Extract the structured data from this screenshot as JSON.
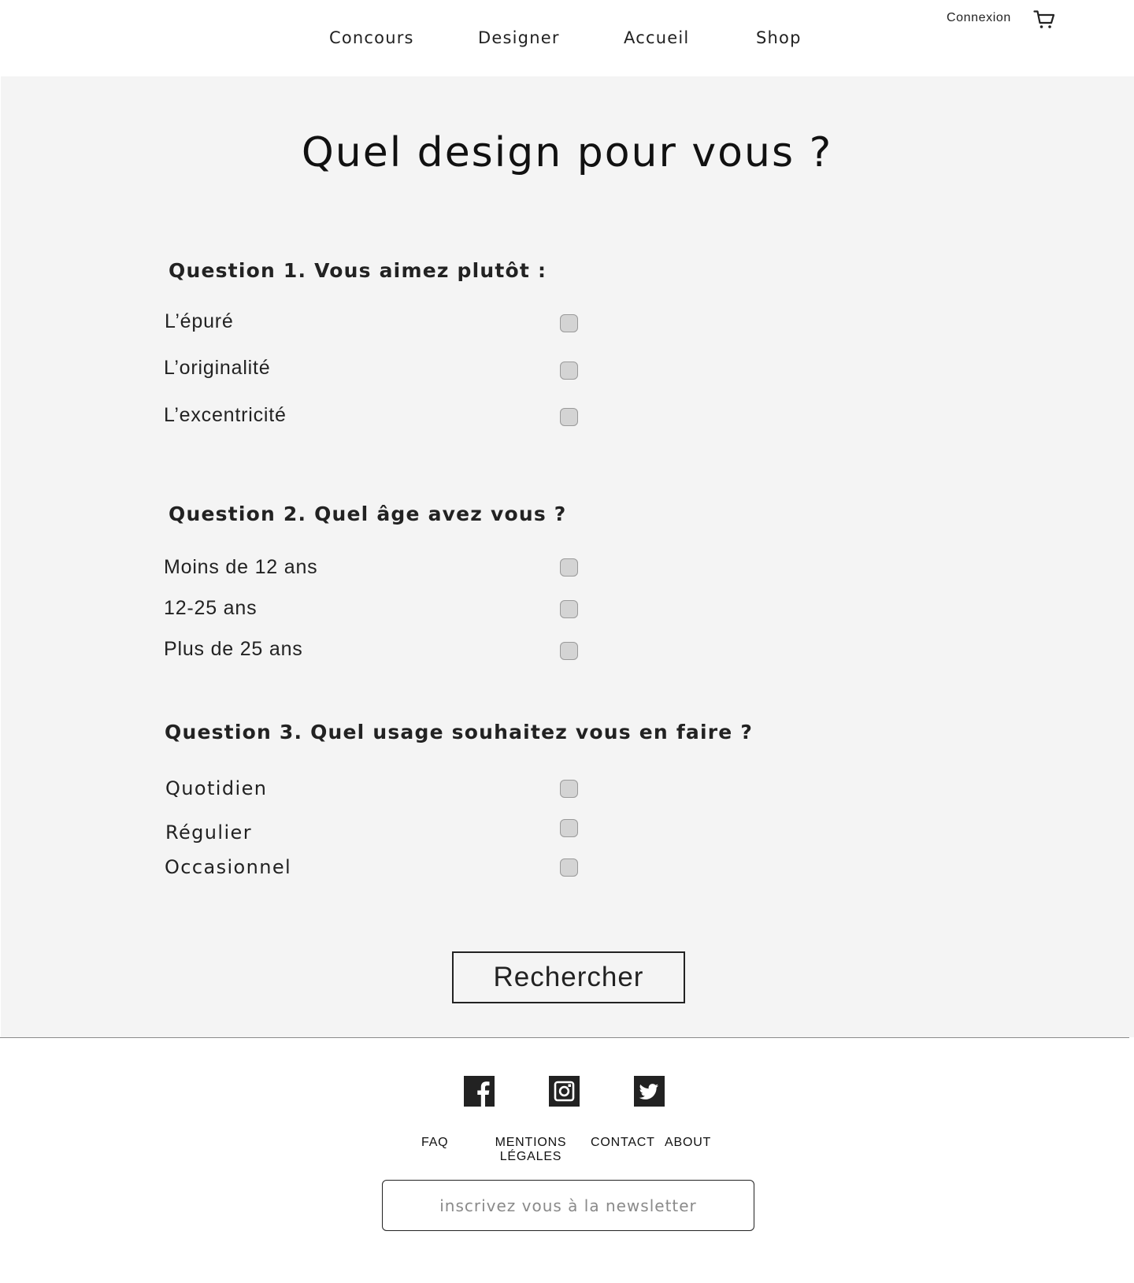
{
  "nav": {
    "items": [
      {
        "label": "Concours"
      },
      {
        "label": "Designer"
      },
      {
        "label": "Accueil"
      },
      {
        "label": "Shop"
      }
    ],
    "connexion_label": "Connexion",
    "cart_icon": "cart-icon"
  },
  "main": {
    "title": "Quel design pour vous ?",
    "questions": [
      {
        "label": "Question 1. Vous aimez plutôt :",
        "options": [
          {
            "label": "L’épuré",
            "checked": false
          },
          {
            "label": "L’originalité",
            "checked": false
          },
          {
            "label": "L’excentricité",
            "checked": false
          }
        ]
      },
      {
        "label": "Question 2.  Quel âge avez vous ?",
        "options": [
          {
            "label": "Moins de 12 ans",
            "checked": false
          },
          {
            "label": "12-25 ans",
            "checked": false
          },
          {
            "label": "Plus de 25 ans",
            "checked": false
          }
        ]
      },
      {
        "label": "Question 3. Quel usage souhaitez vous en faire ?",
        "options": [
          {
            "label": "Quotidien",
            "checked": false
          },
          {
            "label": "Régulier",
            "checked": false
          },
          {
            "label": "Occasionnel",
            "checked": false
          }
        ]
      }
    ],
    "search_button": "Rechercher"
  },
  "footer": {
    "social": [
      {
        "icon": "facebook-icon"
      },
      {
        "icon": "instagram-icon"
      },
      {
        "icon": "twitter-icon"
      }
    ],
    "links": {
      "faq": "FAQ",
      "mentions_line1": "MENTIONS",
      "mentions_line2": "LÉGALES",
      "contact": "CONTACT",
      "about": "ABOUT"
    },
    "newsletter_placeholder": "inscrivez vous à la newsletter"
  },
  "colors": {
    "background": "#ffffff",
    "panel": "#f4f4f4",
    "text": "#222222",
    "checkbox_fill": "#d4d4d4"
  }
}
